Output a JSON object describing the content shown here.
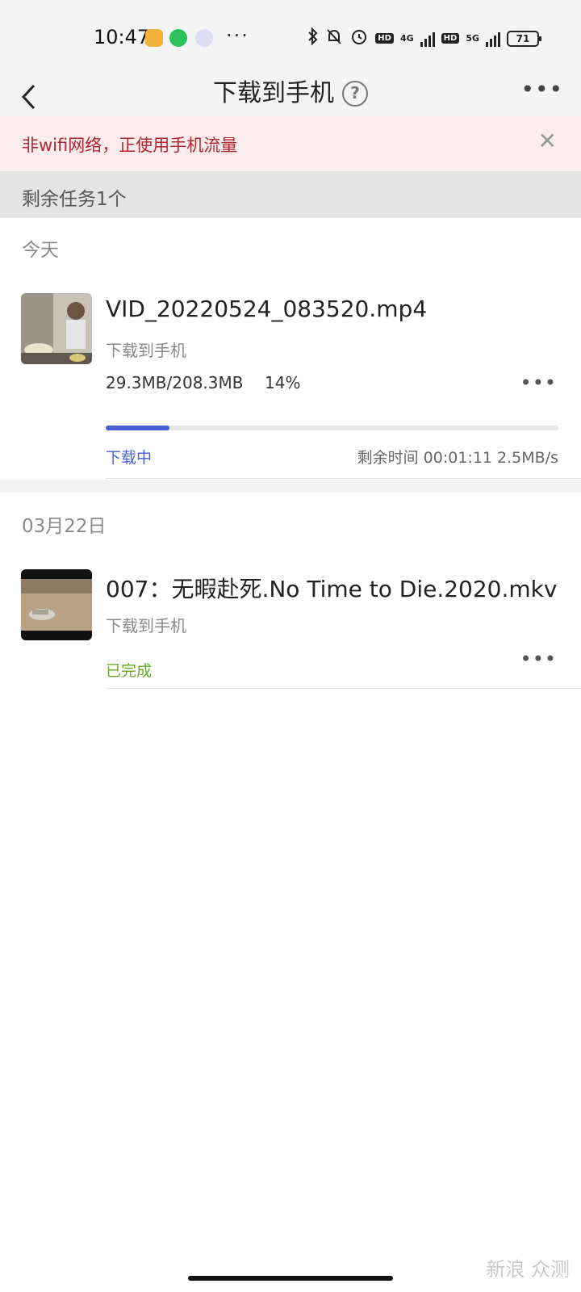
{
  "status_bar": {
    "time": "10:47",
    "dots": "···",
    "signal_4g": "4G",
    "signal_5g": "5G",
    "hd": "HD",
    "battery": "71"
  },
  "header": {
    "title": "下载到手机",
    "help_symbol": "?"
  },
  "banner": {
    "text": "非wifi网络，正使用手机流量"
  },
  "tasks": {
    "remaining_text": "剩余任务1个"
  },
  "sections": [
    {
      "label": "今天",
      "item": {
        "file_name": "VID_20220524_083520.mp4",
        "destination": "下载到手机",
        "size_progress": "29.3MB/208.3MB",
        "percent": "14%",
        "progress_value": 0.14,
        "status": "下载中",
        "remaining": "剩余时间 00:01:11 2.5MB/s"
      }
    },
    {
      "label": "03月22日",
      "item": {
        "file_name": "007：无暇赴死.No Time to Die.2020.mkv",
        "destination": "下载到手机",
        "status": "已完成"
      }
    }
  ],
  "watermark": "新浪 众测",
  "colors": {
    "accent": "#4a5fd6",
    "done": "#6aa62c",
    "warning": "#b02532"
  }
}
